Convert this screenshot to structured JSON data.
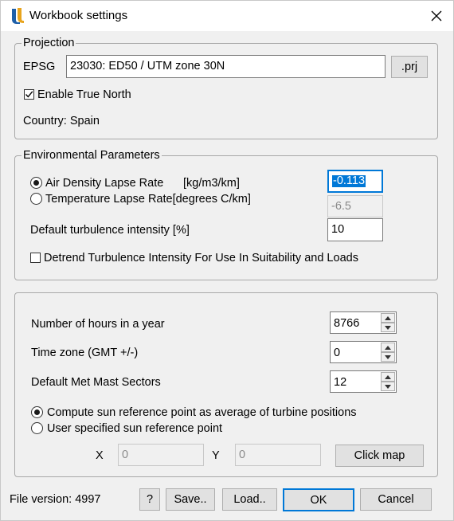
{
  "window": {
    "title": "Workbook settings",
    "close_icon": "close-icon",
    "logo_icon": "app-logo-icon"
  },
  "projection": {
    "legend": "Projection",
    "epsg_label": "EPSG",
    "epsg_value": "23030: ED50 / UTM zone 30N",
    "prj_button": ".prj",
    "true_north_label": "Enable True North",
    "true_north_checked": true,
    "country": "Country: Spain"
  },
  "environmental": {
    "legend": "Environmental Parameters",
    "air_density_label": "Air Density Lapse Rate",
    "air_density_unit": "[kg/m3/km]",
    "air_density_value": "-0.113",
    "temperature_label": "Temperature Lapse Rate[degrees C/km]",
    "temperature_value": "-6.5",
    "selected_option": "air_density",
    "turbulence_label": "Default turbulence intensity [%]",
    "turbulence_value": "10",
    "detrend_label": "Detrend Turbulence Intensity For Use In Suitability and Loads",
    "detrend_checked": false
  },
  "general": {
    "hours_label": "Number of hours in a year",
    "hours_value": "8766",
    "timezone_label": "Time zone (GMT +/-)",
    "timezone_value": "0",
    "sectors_label": "Default Met Mast Sectors",
    "sectors_value": "12",
    "sun_option_average": "Compute sun reference point as average of turbine positions",
    "sun_option_user": "User specified sun reference point",
    "sun_selected": "average",
    "x_label": "X",
    "x_value": "0",
    "y_label": "Y",
    "y_value": "0",
    "click_map_button": "Click map"
  },
  "footer": {
    "file_version": "File version: 4997",
    "help_button": "?",
    "save_button": "Save..",
    "load_button": "Load..",
    "ok_button": "OK",
    "cancel_button": "Cancel"
  },
  "colors": {
    "accent": "#0078d7",
    "window_bg": "#f0f0f0",
    "titlebar_bg": "#ffffff"
  }
}
